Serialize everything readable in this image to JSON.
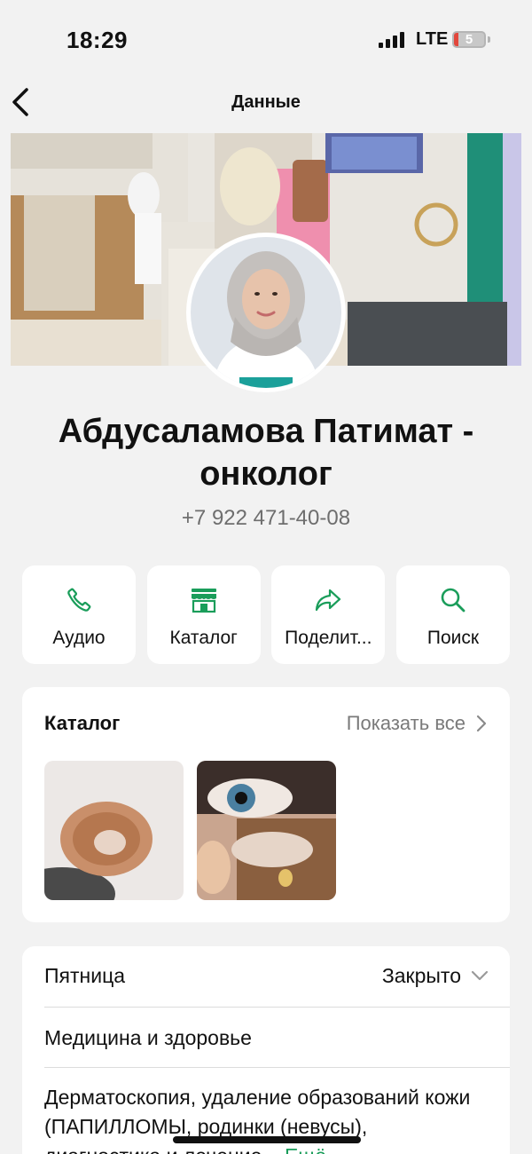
{
  "status_bar": {
    "time": "18:29",
    "network": "LTE",
    "battery_level": "5"
  },
  "nav": {
    "title": "Данные",
    "back_icon": "chevron-left-icon"
  },
  "profile": {
    "name": "Абдусаламова Патимат - онколог",
    "phone": "+7 922 471-40-08"
  },
  "actions": [
    {
      "label": "Аудио",
      "icon": "phone-icon"
    },
    {
      "label": "Каталог",
      "icon": "store-icon"
    },
    {
      "label": "Поделит...",
      "icon": "share-icon"
    },
    {
      "label": "Поиск",
      "icon": "search-icon"
    }
  ],
  "catalog": {
    "title": "Каталог",
    "show_all": "Показать все",
    "items": [
      {
        "icon": "skin-lesion-photo"
      },
      {
        "icon": "eye-papilloma-photo"
      }
    ]
  },
  "info": {
    "day": "Пятница",
    "status": "Закрыто",
    "category": "Медицина и здоровье",
    "description": "Дерматоскопия, удаление образований кожи (ПАПИЛЛОМЫ, родинки (невусы), диагностика и лечение...",
    "more_link": "Ещё"
  },
  "colors": {
    "accent": "#1a9d5a",
    "background": "#f2f2f2",
    "card": "#ffffff"
  }
}
